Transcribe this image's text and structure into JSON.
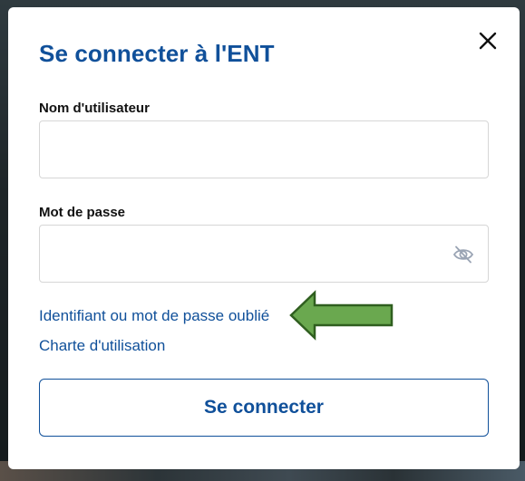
{
  "modal": {
    "title": "Se connecter à l'ENT",
    "close_icon": "close-icon"
  },
  "username": {
    "label": "Nom d'utilisateur",
    "value": "",
    "placeholder": ""
  },
  "password": {
    "label": "Mot de passe",
    "value": "",
    "placeholder": "",
    "toggle_icon": "eye-slash-icon"
  },
  "links": {
    "forgot": "Identifiant ou mot de passe oublié",
    "charter": "Charte d'utilisation"
  },
  "submit": {
    "label": "Se connecter"
  },
  "annotation": {
    "arrow_color": "#6aa84f",
    "arrow_border": "#2f5e1f"
  },
  "colors": {
    "accent": "#10509a"
  }
}
